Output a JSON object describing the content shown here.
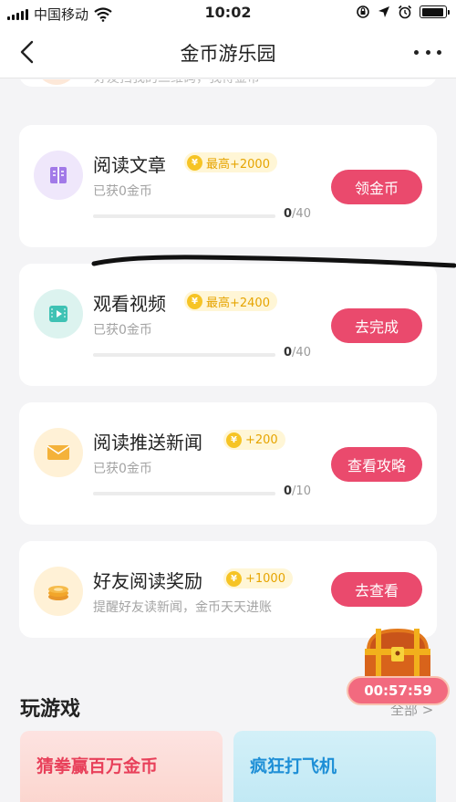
{
  "status_bar": {
    "carrier": "中国移动",
    "time": "10:02"
  },
  "nav": {
    "title": "金币游乐园"
  },
  "partial_task": {
    "text": "好友扫我的二维码，我得金币"
  },
  "tasks": [
    {
      "title": "阅读文章",
      "reward": "最高+2000",
      "coin_symbol": "¥",
      "subtitle": "已获0金币",
      "progress_current": "0",
      "progress_total": "/40",
      "progress_value": 0,
      "button": "领金币",
      "icon": "book-icon",
      "icon_bg": "#efe7fb",
      "icon_color": "#a27ae8"
    },
    {
      "title": "观看视频",
      "reward": "最高+2400",
      "coin_symbol": "¥",
      "subtitle": "已获0金币",
      "progress_current": "0",
      "progress_total": "/40",
      "progress_value": 0,
      "button": "去完成",
      "icon": "video-icon",
      "icon_bg": "#dcf3ef",
      "icon_color": "#3fc2b4"
    },
    {
      "title": "阅读推送新闻",
      "reward": "+200",
      "coin_symbol": "¥",
      "subtitle": "已获0金币",
      "progress_current": "0",
      "progress_total": "/10",
      "progress_value": 0,
      "button": "查看攻略",
      "icon": "envelope-icon",
      "icon_bg": "#fff1d6",
      "icon_color": "#f4b23a"
    },
    {
      "title": "好友阅读奖励",
      "reward": "+1000",
      "coin_symbol": "¥",
      "subtitle": "提醒好友读新闻，金币天天进账",
      "button": "去查看",
      "icon": "coin-stack-icon",
      "icon_bg": "#fff1d6",
      "icon_color": "#f2a62a"
    }
  ],
  "games_section": {
    "title": "玩游戏",
    "see_all": "全部 >",
    "games": [
      {
        "title": "猜拳赢百万金币"
      },
      {
        "title": "疯狂打飞机"
      }
    ]
  },
  "chest": {
    "timer": "00:57:59"
  },
  "colors": {
    "accent": "#ea4a6d",
    "badge_text": "#e6a400",
    "badge_bg": "#fff6d6"
  }
}
